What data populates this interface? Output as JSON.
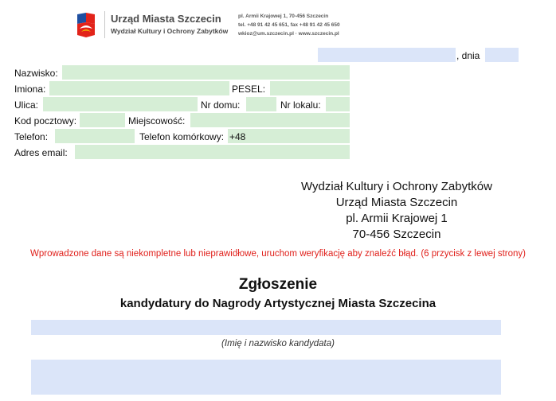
{
  "header": {
    "org_name": "Urząd Miasta Szczecin",
    "department": "Wydział Kultury i Ochrony Zabytków",
    "address_line": "pl. Armii Krajowej 1, 70-456 Szczecin",
    "phone_line": "tel. +48 91 42 45 651, fax +48 91 42 45 650",
    "web_line": "wkioz@um.szczecin.pl · www.szczecin.pl",
    "logo_colors": [
      "#1f4fa0",
      "#e2231a",
      "#f5c400"
    ]
  },
  "date_row": {
    "separator": ", dnia"
  },
  "form": {
    "nazwisko": "Nazwisko:",
    "imiona": "Imiona:",
    "pesel": "PESEL:",
    "ulica": "Ulica:",
    "nr_domu": "Nr domu:",
    "nr_lokalu": "Nr lokalu:",
    "kod": "Kod pocztowy:",
    "miejscowosc": "Miejscowość:",
    "telefon": "Telefon:",
    "telefon_kom": "Telefon komórkowy:",
    "telefon_prefix": "+48",
    "email": "Adres email:"
  },
  "recipient": {
    "line1": "Wydział Kultury i Ochrony Zabytków",
    "line2": "Urząd Miasta Szczecin",
    "line3": "pl. Armii Krajowej 1",
    "line4": "70-456 Szczecin"
  },
  "warning": "Wprowadzone dane są niekompletne lub nieprawidłowe, uruchom weryfikację aby znaleźć błąd. (6 przycisk z lewej strony)",
  "doc": {
    "title": "Zgłoszenie",
    "subtitle": "kandydatury do Nagrody Artystycznej Miasta Szczecina",
    "candidate_caption": "(Imię i nazwisko kandydata)"
  },
  "colors": {
    "field_green": "#d6eed6",
    "field_blue": "#dbe5f9",
    "warning_red": "#e0201b"
  }
}
